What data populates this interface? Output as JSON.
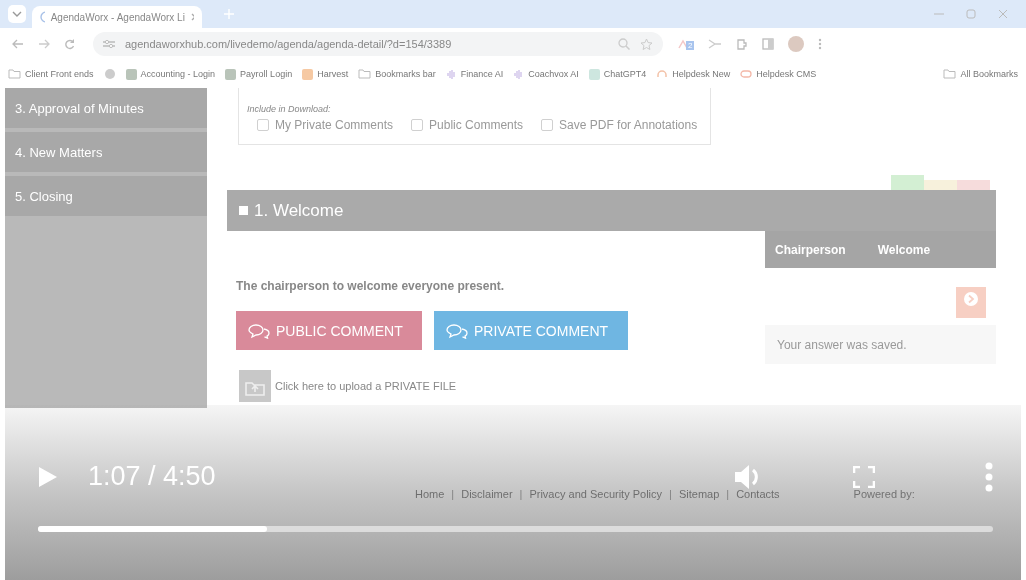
{
  "browser": {
    "tab_title": "AgendaWorx - AgendaWorx Li",
    "url": "agendaworxhub.com/livedemo/agenda/agenda-detail/?d=154/3389",
    "extension_badge": "2",
    "all_bookmarks": "All Bookmarks",
    "bookmarks": [
      {
        "label": "Client Front ends",
        "kind": "folder"
      },
      {
        "label": "Accounting - Login",
        "kind": "sheet"
      },
      {
        "label": "Payroll Login",
        "kind": "sheet"
      },
      {
        "label": "Harvest",
        "kind": "harvest"
      },
      {
        "label": "Bookmarks bar",
        "kind": "folder"
      },
      {
        "label": "Finance AI",
        "kind": "wave"
      },
      {
        "label": "Coachvox AI",
        "kind": "wave"
      },
      {
        "label": "ChatGPT4",
        "kind": "chat"
      },
      {
        "label": "Helpdesk New",
        "kind": "headset"
      },
      {
        "label": "Helpdesk CMS",
        "kind": "cms"
      }
    ]
  },
  "sidebar": {
    "items": [
      {
        "label": "3. Approval of Minutes"
      },
      {
        "label": "4. New Matters"
      },
      {
        "label": "5. Closing"
      }
    ]
  },
  "download": {
    "label": "Include in Download:",
    "options": [
      {
        "label": "My Private Comments",
        "checked": false
      },
      {
        "label": "Public Comments",
        "checked": false
      },
      {
        "label": "Save PDF for Annotations",
        "checked": false
      }
    ]
  },
  "item": {
    "title": "1. Welcome",
    "tags": [
      {
        "color": "#d3efd3"
      },
      {
        "color": "#f7f1dc"
      },
      {
        "color": "#f6dcdc"
      }
    ],
    "columns": [
      "Chairperson",
      "Welcome"
    ],
    "description": "The chairperson to welcome everyone present.",
    "buttons": [
      {
        "label": "PUBLIC COMMENT",
        "kind": "public"
      },
      {
        "label": "PRIVATE COMMENT",
        "kind": "private"
      }
    ],
    "saved_message": "Your answer was saved.",
    "upload": "Click here to upload a PRIVATE FILE"
  },
  "footer": {
    "items": [
      {
        "text": "Home",
        "kind": "link"
      },
      {
        "text": "|",
        "kind": "separator"
      },
      {
        "text": "Disclaimer",
        "kind": "link"
      },
      {
        "text": "|",
        "kind": "separator"
      },
      {
        "text": "Privacy and Security Policy",
        "kind": "link"
      },
      {
        "text": "|",
        "kind": "separator"
      },
      {
        "text": "Sitemap",
        "kind": "link"
      },
      {
        "text": "|",
        "kind": "separator"
      },
      {
        "text": "Contacts",
        "kind": "link"
      }
    ],
    "powered_by": "Powered by:"
  },
  "player": {
    "playing": false,
    "time": "1:07 / 4:50",
    "level": 0.24
  }
}
